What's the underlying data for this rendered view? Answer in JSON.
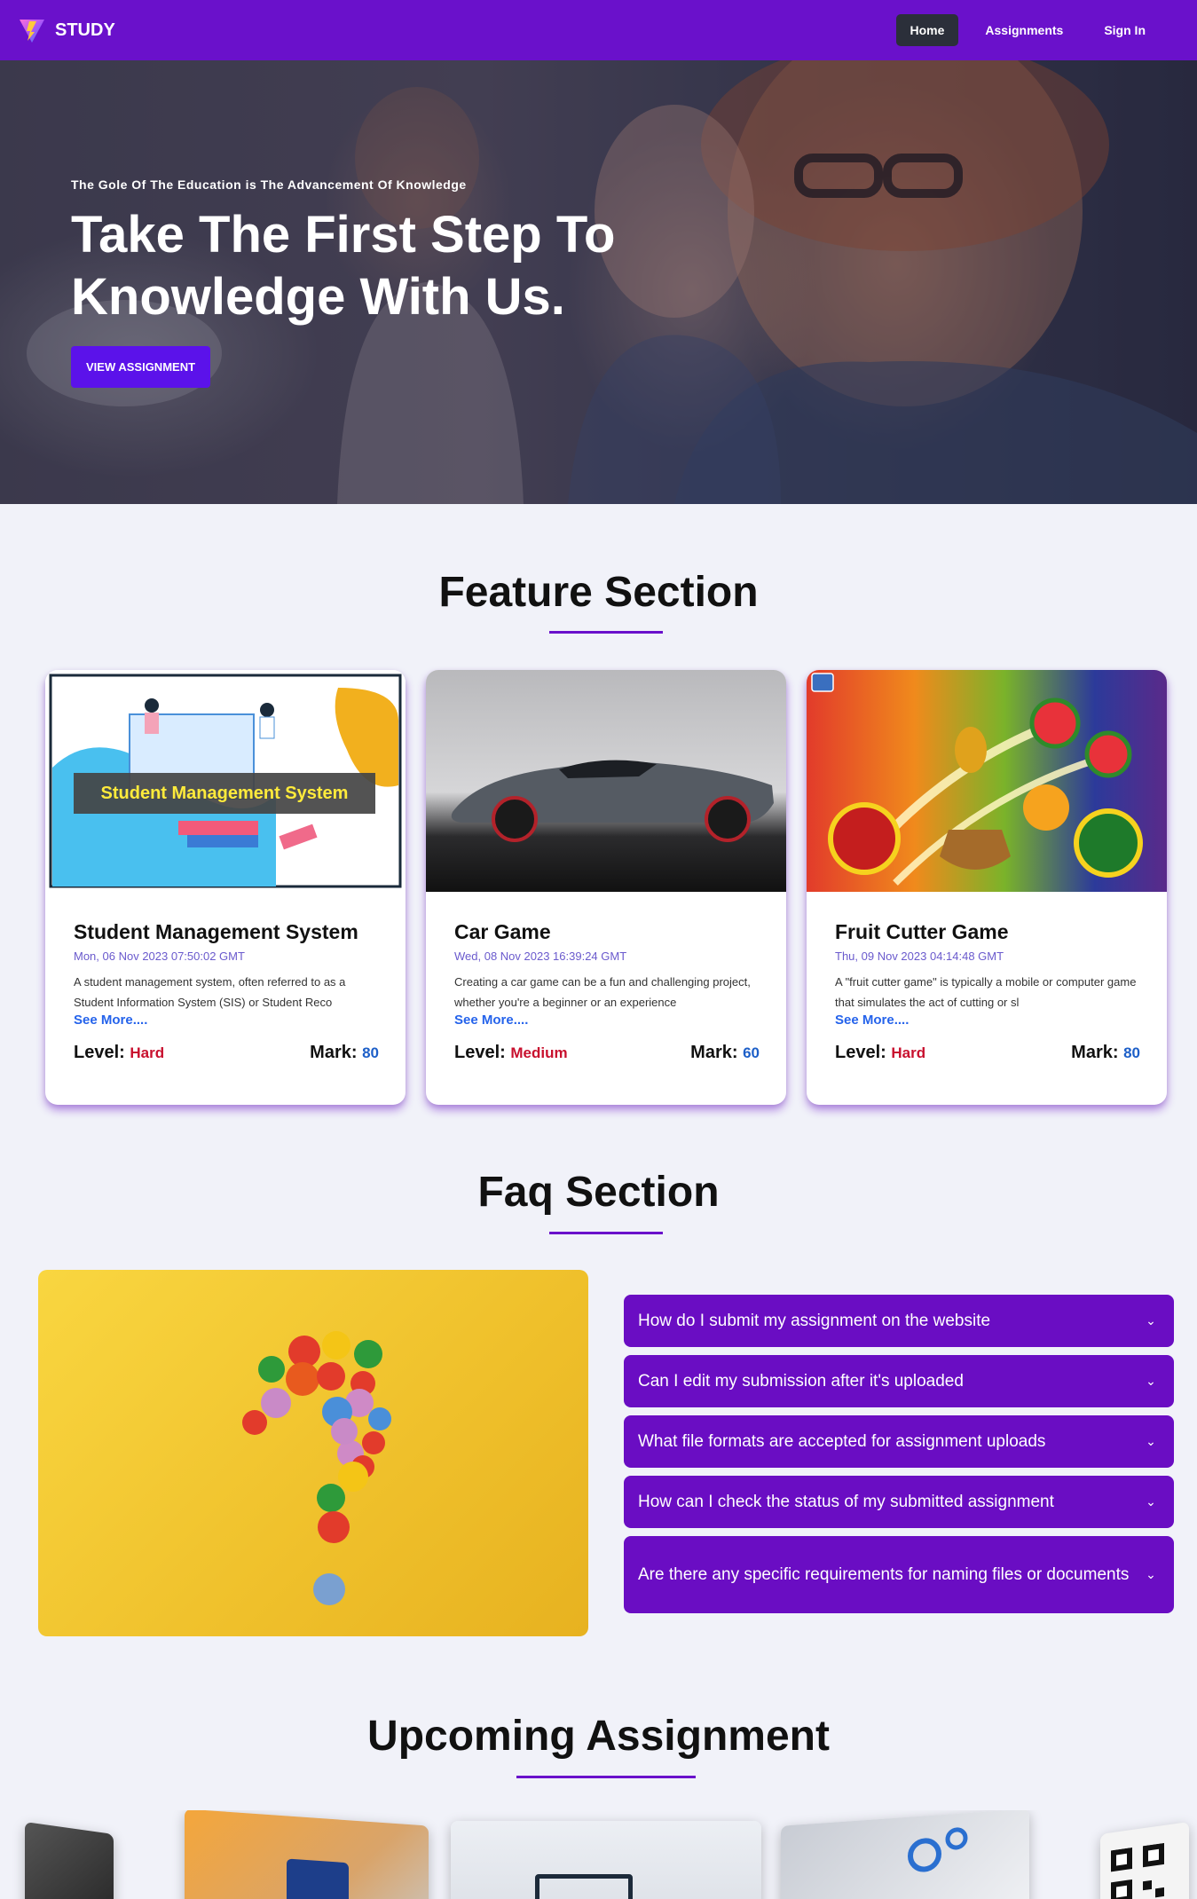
{
  "nav": {
    "brand": "STUDY",
    "links": [
      {
        "label": "Home",
        "active": true
      },
      {
        "label": "Assignments",
        "active": false
      },
      {
        "label": "Sign In",
        "active": false
      }
    ]
  },
  "hero": {
    "subtitle": "The Gole Of The Education is The Advancement Of Knowledge",
    "title": "Take The First Step To Knowledge With Us.",
    "button": "VIEW ASSIGNMENT"
  },
  "features": {
    "title": "Feature Section",
    "cards": [
      {
        "image_caption": "Student Management System",
        "title": "Student Management System",
        "date": "Mon, 06 Nov 2023 07:50:02 GMT",
        "description": "A student management system, often referred to as a Student Information System (SIS) or Student Reco",
        "see_more": "See More....",
        "level_label": "Level:",
        "level": "Hard",
        "mark_label": "Mark:",
        "mark": "80"
      },
      {
        "title": "Car Game",
        "date": "Wed, 08 Nov 2023 16:39:24 GMT",
        "description": "Creating a car game can be a fun and challenging project, whether you're a beginner or an experience",
        "see_more": "See More....",
        "level_label": "Level:",
        "level": "Medium",
        "mark_label": "Mark:",
        "mark": "60"
      },
      {
        "title": "Fruit Cutter Game",
        "date": "Thu, 09 Nov 2023 04:14:48 GMT",
        "description": "A \"fruit cutter game\" is typically a mobile or computer game that simulates the act of cutting or sl",
        "see_more": "See More....",
        "level_label": "Level:",
        "level": "Hard",
        "mark_label": "Mark:",
        "mark": "80"
      }
    ]
  },
  "faq": {
    "title": "Faq Section",
    "items": [
      "How do I submit my assignment on the website",
      "Can I edit my submission after it's uploaded",
      "What file formats are accepted for assignment uploads",
      "How can I check the status of my submitted assignment",
      "Are there any specific requirements for naming files or documents"
    ]
  },
  "upcoming": {
    "title": "Upcoming Assignment"
  },
  "colors": {
    "primary": "#6a11cb",
    "faq_bg": "#6a0dc3",
    "button": "#5b12ea",
    "level": "#c8102e",
    "mark": "#1d5fc8",
    "page_bg": "#f1f2f9"
  }
}
